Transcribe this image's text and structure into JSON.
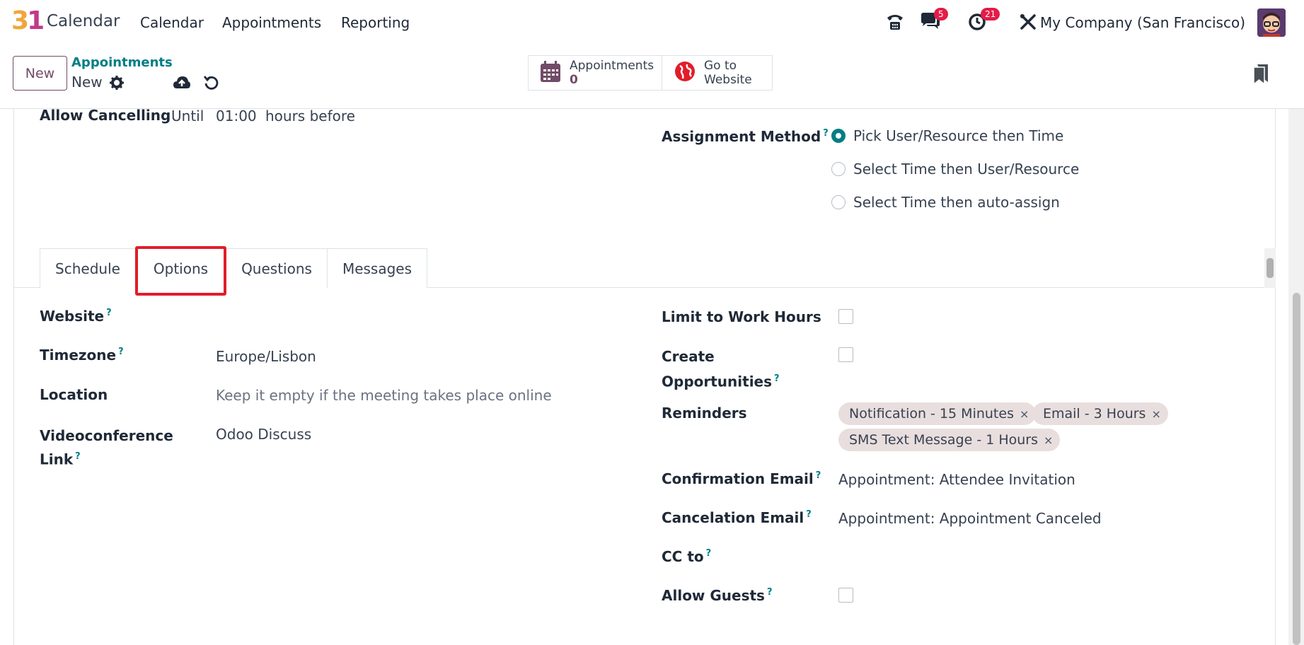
{
  "navbar": {
    "logo_text": "31",
    "app_title": "Calendar",
    "menu": [
      "Calendar",
      "Appointments",
      "Reporting"
    ],
    "messages_badge": "5",
    "activities_badge": "21",
    "company": "My Company (San Francisco)"
  },
  "control": {
    "new_label": "New",
    "breadcrumb_parent": "Appointments",
    "breadcrumb_current": "New",
    "smart_appointments_label": "Appointments",
    "smart_appointments_count": "0",
    "smart_website_label_1": "Go to",
    "smart_website_label_2": "Website"
  },
  "top_fields": {
    "allow_cancelling_label": "Allow Cancelling",
    "allow_cancelling_until": "Until",
    "allow_cancelling_value": "01:00",
    "allow_cancelling_suffix": "hours before",
    "assignment_method_label": "Assignment Method",
    "assignment_options": [
      {
        "label": "Pick User/Resource then Time",
        "selected": true
      },
      {
        "label": "Select Time then User/Resource",
        "selected": false
      },
      {
        "label": "Select Time then auto-assign",
        "selected": false
      }
    ]
  },
  "tabs": [
    {
      "label": "Schedule",
      "active": false
    },
    {
      "label": "Options",
      "active": true
    },
    {
      "label": "Questions",
      "active": false
    },
    {
      "label": "Messages",
      "active": false
    }
  ],
  "options_left": {
    "website_label": "Website",
    "timezone_label": "Timezone",
    "timezone_value": "Europe/Lisbon",
    "location_label": "Location",
    "location_placeholder": "Keep it empty if the meeting takes place online",
    "video_label_1": "Videoconference",
    "video_label_2": "Link",
    "video_value": "Odoo Discuss"
  },
  "options_right": {
    "limit_work_hours_label": "Limit to Work Hours",
    "limit_work_hours_checked": false,
    "create_opps_label_1": "Create",
    "create_opps_label_2": "Opportunities",
    "create_opps_checked": false,
    "reminders_label": "Reminders",
    "reminders": [
      "Notification - 15 Minutes",
      "Email - 3 Hours",
      "SMS Text Message - 1 Hours"
    ],
    "confirmation_email_label": "Confirmation Email",
    "confirmation_email_value": "Appointment: Attendee Invitation",
    "cancelation_email_label": "Cancelation Email",
    "cancelation_email_value": "Appointment: Appointment Canceled",
    "cc_to_label": "CC to",
    "allow_guests_label": "Allow Guests",
    "allow_guests_checked": false
  },
  "help_mark": "?",
  "remove_mark": "×",
  "colors": {
    "brand": "#714b67",
    "teal": "#017e84",
    "badge": "#e11d48",
    "highlight": "#e11d2a",
    "tag_bg": "#e9dede"
  }
}
